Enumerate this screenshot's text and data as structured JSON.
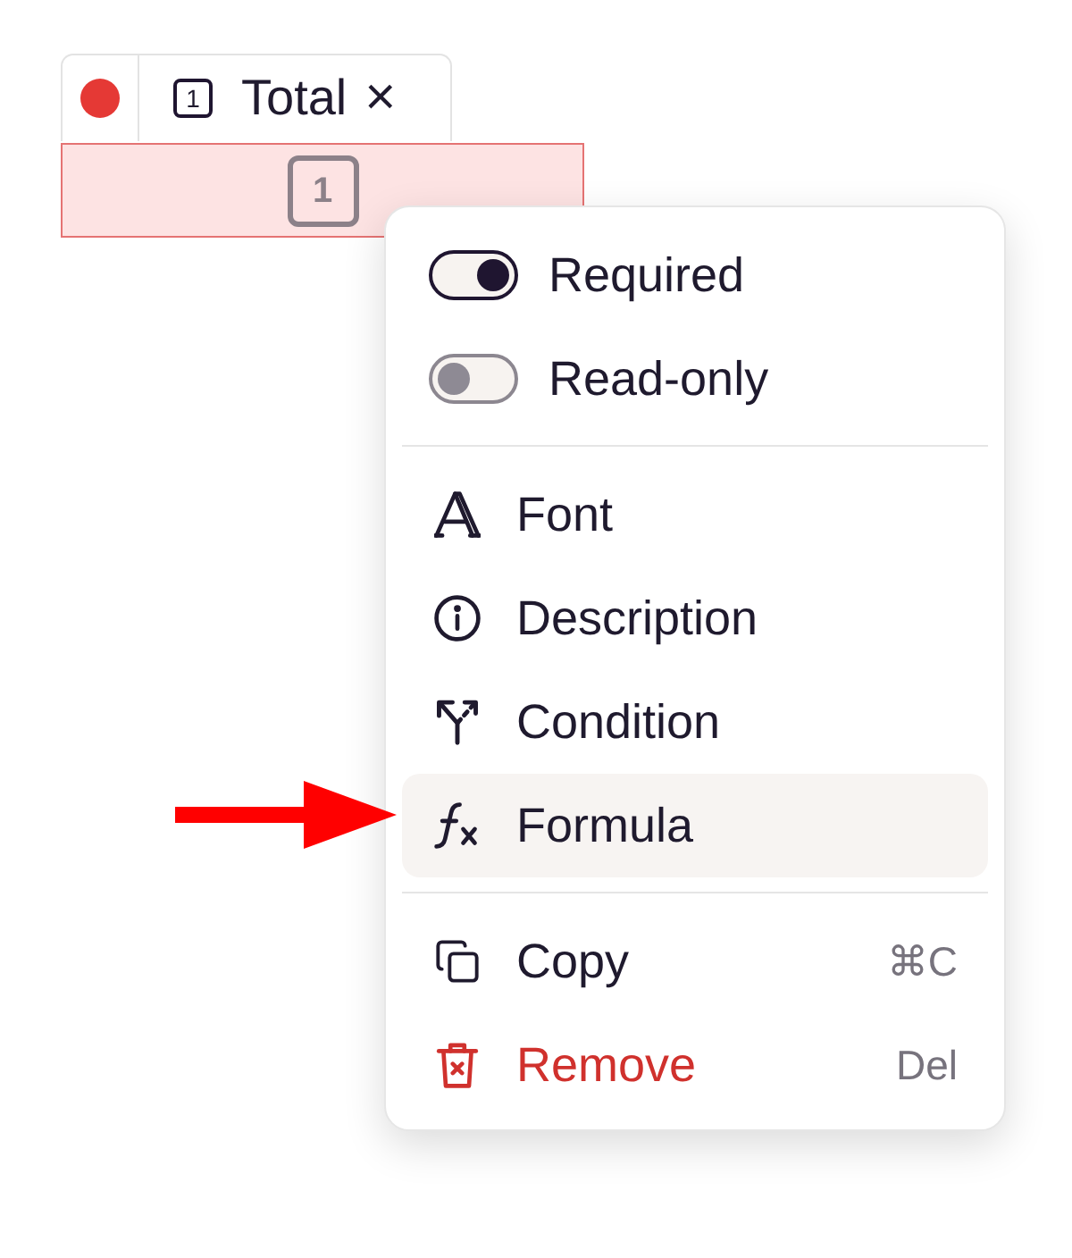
{
  "field": {
    "error": true,
    "badge": "1",
    "label": "Total",
    "close_glyph": "×",
    "input_badge": "1"
  },
  "menu": {
    "toggles": [
      {
        "label": "Required",
        "on": true
      },
      {
        "label": "Read-only",
        "on": false
      }
    ],
    "options": [
      {
        "label": "Font",
        "selected": false
      },
      {
        "label": "Description",
        "selected": false
      },
      {
        "label": "Condition",
        "selected": false
      },
      {
        "label": "Formula",
        "selected": true
      }
    ],
    "actions": [
      {
        "label": "Copy",
        "shortcut": "⌘C",
        "danger": false,
        "selected": false
      },
      {
        "label": "Remove",
        "shortcut": "Del",
        "danger": true,
        "selected": false
      }
    ]
  }
}
